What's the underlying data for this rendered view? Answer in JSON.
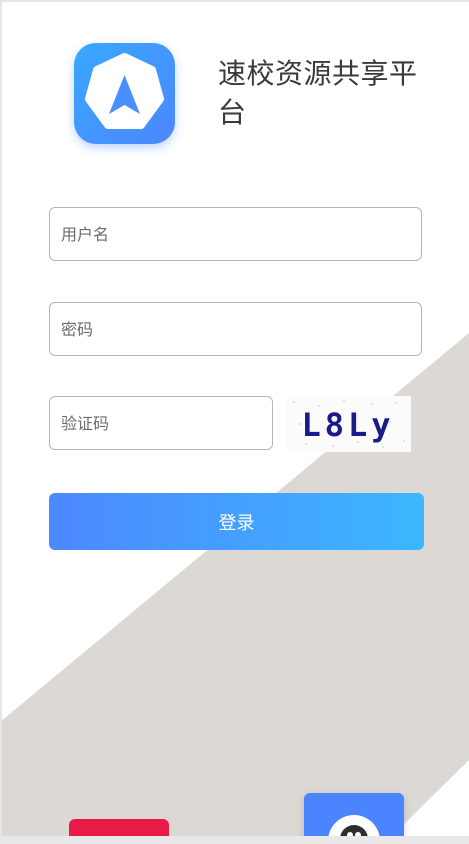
{
  "app": {
    "title": "速校资源共享平台"
  },
  "form": {
    "username_placeholder": "用户名",
    "password_placeholder": "密码",
    "captcha_placeholder": "验证码",
    "captcha_text": "L8Ly",
    "login_label": "登录"
  },
  "colors": {
    "accent_start": "#4c88ff",
    "accent_end": "#3cb7ff",
    "diagonal_bg": "#dcd9d5",
    "red_button": "#ea1a48"
  },
  "icons": {
    "logo": "navigation-arrow-icon",
    "avatar": "avatar-icon"
  }
}
